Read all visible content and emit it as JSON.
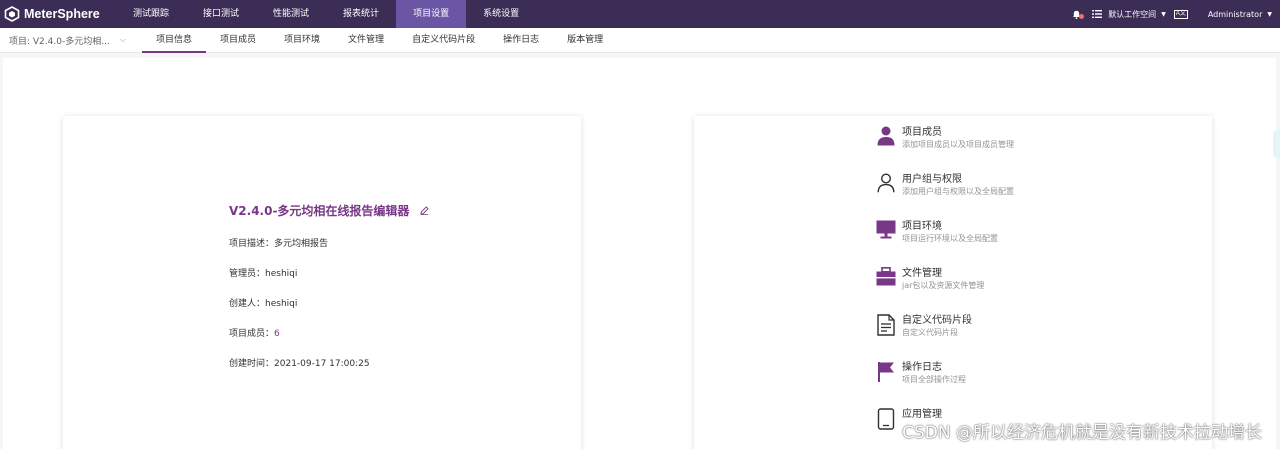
{
  "app": {
    "name": "MeterSphere"
  },
  "nav": [
    {
      "label": "测试跟踪",
      "active": false
    },
    {
      "label": "接口测试",
      "active": false
    },
    {
      "label": "性能测试",
      "active": false
    },
    {
      "label": "报表统计",
      "active": false
    },
    {
      "label": "项目设置",
      "active": true
    },
    {
      "label": "系统设置",
      "active": false
    }
  ],
  "topbar": {
    "workspace": "默认工作空间",
    "lang_badge": "A文",
    "user": "Administrator"
  },
  "subbar": {
    "project": "项目: V2.4.0-多元均相...",
    "tabs": [
      {
        "label": "项目信息",
        "active": true
      },
      {
        "label": "项目成员",
        "active": false
      },
      {
        "label": "项目环境",
        "active": false
      },
      {
        "label": "文件管理",
        "active": false
      },
      {
        "label": "自定义代码片段",
        "active": false
      },
      {
        "label": "操作日志",
        "active": false
      },
      {
        "label": "版本管理",
        "active": false
      }
    ]
  },
  "project_info": {
    "title": "V2.4.0-多元均相在线报告编辑器",
    "rows": [
      {
        "label": "项目描述：",
        "value": "多元均相报告",
        "link": false
      },
      {
        "label": "管理员：",
        "value": "heshiqi",
        "link": false
      },
      {
        "label": "创建人：",
        "value": "heshiqi",
        "link": false
      },
      {
        "label": "项目成员：",
        "value": "6",
        "link": true
      },
      {
        "label": "创建时间：",
        "value": "2021-09-17 17:00:25",
        "link": false
      }
    ]
  },
  "menu": [
    {
      "icon": "user-filled-icon",
      "title": "项目成员",
      "desc": "添加项目成员以及项目成员管理"
    },
    {
      "icon": "user-outline-icon",
      "title": "用户组与权限",
      "desc": "添加用户组与权限以及全局配置"
    },
    {
      "icon": "monitor-icon",
      "title": "项目环境",
      "desc": "项目运行环境以及全局配置"
    },
    {
      "icon": "briefcase-icon",
      "title": "文件管理",
      "desc": "jar包以及资源文件管理"
    },
    {
      "icon": "document-icon",
      "title": "自定义代码片段",
      "desc": "自定义代码片段"
    },
    {
      "icon": "flag-icon",
      "title": "操作日志",
      "desc": "项目全部操作过程"
    },
    {
      "icon": "app-icon",
      "title": "应用管理",
      "desc": ""
    }
  ],
  "watermark": "CSDN @所以经济危机就是没有新技术拉动增长",
  "colors": {
    "topbar": "#3b2d55",
    "nav_active": "#6a56a4",
    "accent": "#783887"
  }
}
